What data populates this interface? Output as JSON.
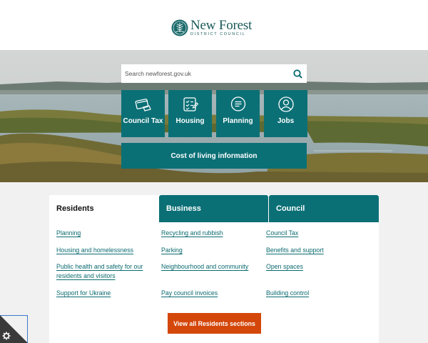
{
  "header": {
    "logo_name": "New Forest",
    "logo_sub": "DISTRICT COUNCIL"
  },
  "search": {
    "placeholder": "Search newforest.gov.uk"
  },
  "quick_links": [
    {
      "label": "Council Tax",
      "icon": "card-payment-icon"
    },
    {
      "label": "Housing",
      "icon": "checklist-icon"
    },
    {
      "label": "Planning",
      "icon": "speech-bubble-icon"
    },
    {
      "label": "Jobs",
      "icon": "person-icon"
    }
  ],
  "cost_of_living": "Cost of living information",
  "tabs": [
    {
      "label": "Residents",
      "active": true
    },
    {
      "label": "Business",
      "active": false
    },
    {
      "label": "Council",
      "active": false
    }
  ],
  "columns": {
    "col1": [
      "Planning",
      "Housing and homelessness",
      "Public health and safety for our residents and visitors",
      "Support for Ukraine"
    ],
    "col2": [
      "Recycling and rubbish",
      "Parking",
      "Neighbourhood and community",
      "Pay council invoices"
    ],
    "col3": [
      "Council Tax",
      "Benefits and support",
      "Open spaces",
      "Building control"
    ]
  },
  "view_all": "View all Residents sections",
  "colors": {
    "brand_teal": "#0b7076",
    "accent_orange": "#d4470b",
    "logo_green": "#1c5a5a"
  }
}
